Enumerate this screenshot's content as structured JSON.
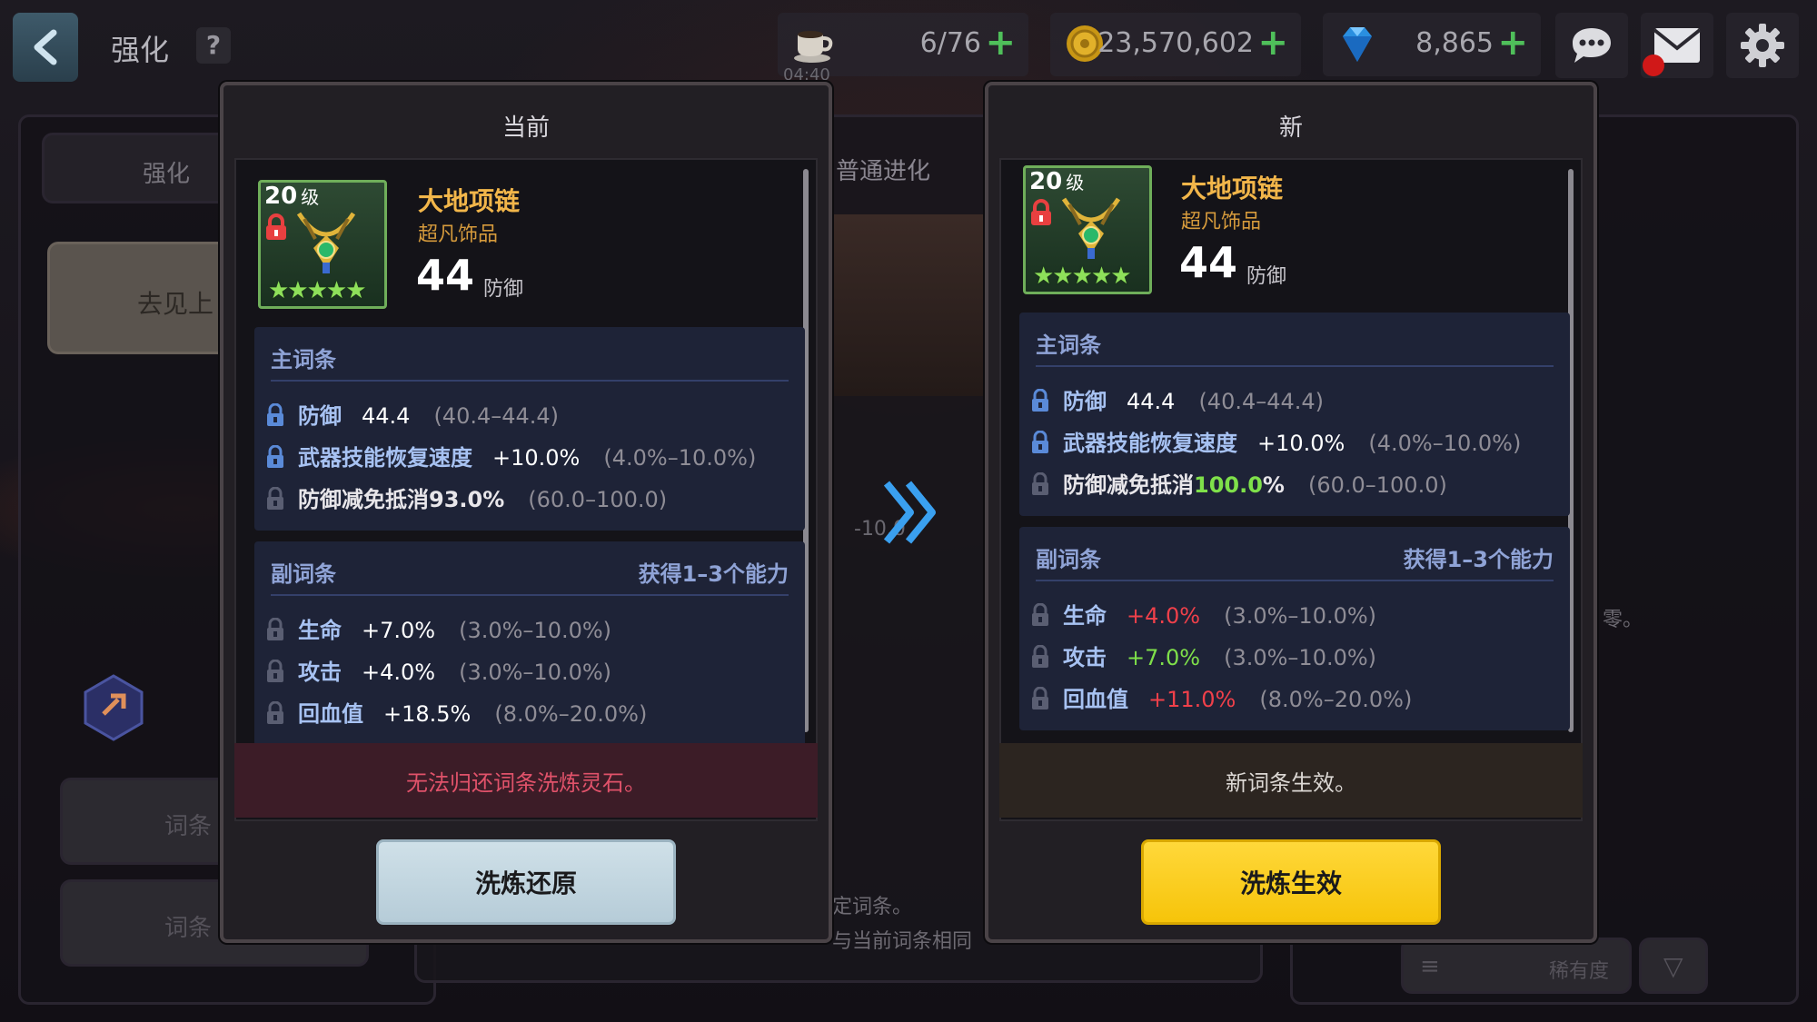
{
  "topbar": {
    "title": "强化",
    "help": "?",
    "stamina": {
      "value": "6/76",
      "timer": "04:40"
    },
    "gold": {
      "value": "23,570,602"
    },
    "gems": {
      "value": "8,865"
    },
    "plus": "+"
  },
  "background": {
    "tab_left": "强化",
    "tab_mid": "普通进化",
    "bubble": "去见上",
    "btn1": "词条",
    "btn2": "词条",
    "range_fragment": "-10.0",
    "note1": "定词条。",
    "note2": "与当前词条相同",
    "note3": "零。",
    "sort_label": "稀有度"
  },
  "current": {
    "header": "当前",
    "level": "20",
    "level_unit": "级",
    "stars": "★★★★★",
    "name": "大地项链",
    "rarity": "超凡饰品",
    "stat_value": "44",
    "stat_label": "防御",
    "main_title": "主词条",
    "main_options": [
      {
        "name": "防御",
        "value": "44.4",
        "range": "(40.4–44.4)"
      },
      {
        "name": "武器技能恢复速度",
        "value": "+10.0%",
        "range": "(4.0%–10.0%)"
      },
      {
        "text": "防御减免抵消93.0%",
        "range": "(60.0–100.0)"
      }
    ],
    "sub_title": "副词条",
    "sub_note": "获得1–3个能力",
    "sub_options": [
      {
        "name": "生命",
        "value": "+7.0%",
        "range": "(3.0%–10.0%)"
      },
      {
        "name": "攻击",
        "value": "+4.0%",
        "range": "(3.0%–10.0%)"
      },
      {
        "name": "回血值",
        "value": "+18.5%",
        "range": "(8.0%–20.0%)"
      }
    ],
    "status": "无法归还词条洗炼灵石。",
    "button": "洗炼还原"
  },
  "new": {
    "header": "新",
    "level": "20",
    "level_unit": "级",
    "stars": "★★★★★",
    "name": "大地项链",
    "rarity": "超凡饰品",
    "stat_value": "44",
    "stat_label": "防御",
    "main_title": "主词条",
    "main_options": [
      {
        "name": "防御",
        "value": "44.4",
        "range": "(40.4–44.4)"
      },
      {
        "name": "武器技能恢复速度",
        "value": "+10.0%",
        "range": "(4.0%–10.0%)"
      },
      {
        "text": "防御减免抵消",
        "highlight": "100.0",
        "suffix": "%",
        "range": "(60.0–100.0)"
      }
    ],
    "sub_title": "副词条",
    "sub_note": "获得1–3个能力",
    "sub_options": [
      {
        "name": "生命",
        "value": "+4.0%",
        "trend": "down",
        "range": "(3.0%–10.0%)"
      },
      {
        "name": "攻击",
        "value": "+7.0%",
        "trend": "up",
        "range": "(3.0%–10.0%)"
      },
      {
        "name": "回血值",
        "value": "+11.0%",
        "trend": "down",
        "range": "(8.0%–20.0%)"
      }
    ],
    "status": "新词条生效。",
    "button": "洗炼生效"
  },
  "colors": {
    "increase": "#7fe04a",
    "decrease": "#f0404a",
    "apply_button": "#f6c40a",
    "revert_button": "#b6ccd8"
  },
  "icons": {
    "back": "chevron-left-icon",
    "stamina": "coffee-cup-icon",
    "gold": "gold-coin-icon",
    "gems": "gem-icon",
    "chat": "chat-icon",
    "mail": "mail-icon",
    "settings": "gear-icon",
    "transition": "double-chevron-right-icon"
  }
}
